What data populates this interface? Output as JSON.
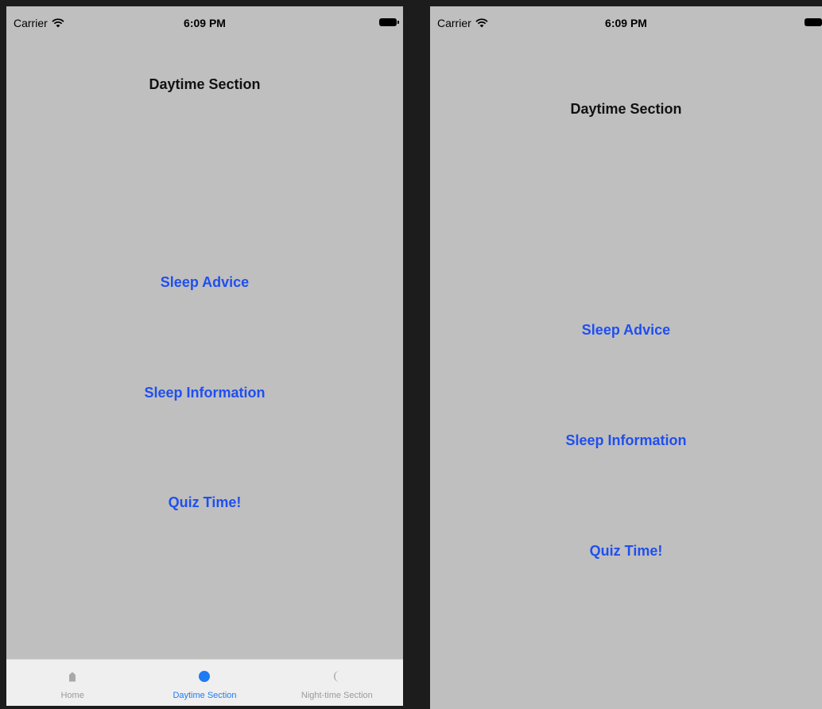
{
  "screens": [
    {
      "status": {
        "carrier": "Carrier",
        "time": "6:09 PM"
      },
      "title": "Daytime Section",
      "buttons": {
        "advice": "Sleep Advice",
        "info": "Sleep Information",
        "quiz": "Quiz Time!"
      },
      "tabs": [
        {
          "label": "Home",
          "icon": "home-icon"
        },
        {
          "label": "Daytime Section",
          "icon": "sun-dot-icon",
          "active": true
        },
        {
          "label": "Night-time Section",
          "icon": "moon-icon"
        }
      ]
    },
    {
      "status": {
        "carrier": "Carrier",
        "time": "6:09 PM"
      },
      "title": "Daytime Section",
      "buttons": {
        "advice": "Sleep Advice",
        "info": "Sleep Information",
        "quiz": "Quiz Time!"
      }
    }
  ],
  "colors": {
    "background": "#bfbfbf",
    "link": "#1f4ff0",
    "tab_active": "#1e7bf3",
    "tab_inactive": "#9a9a9a",
    "tab_bar": "#efefef"
  }
}
